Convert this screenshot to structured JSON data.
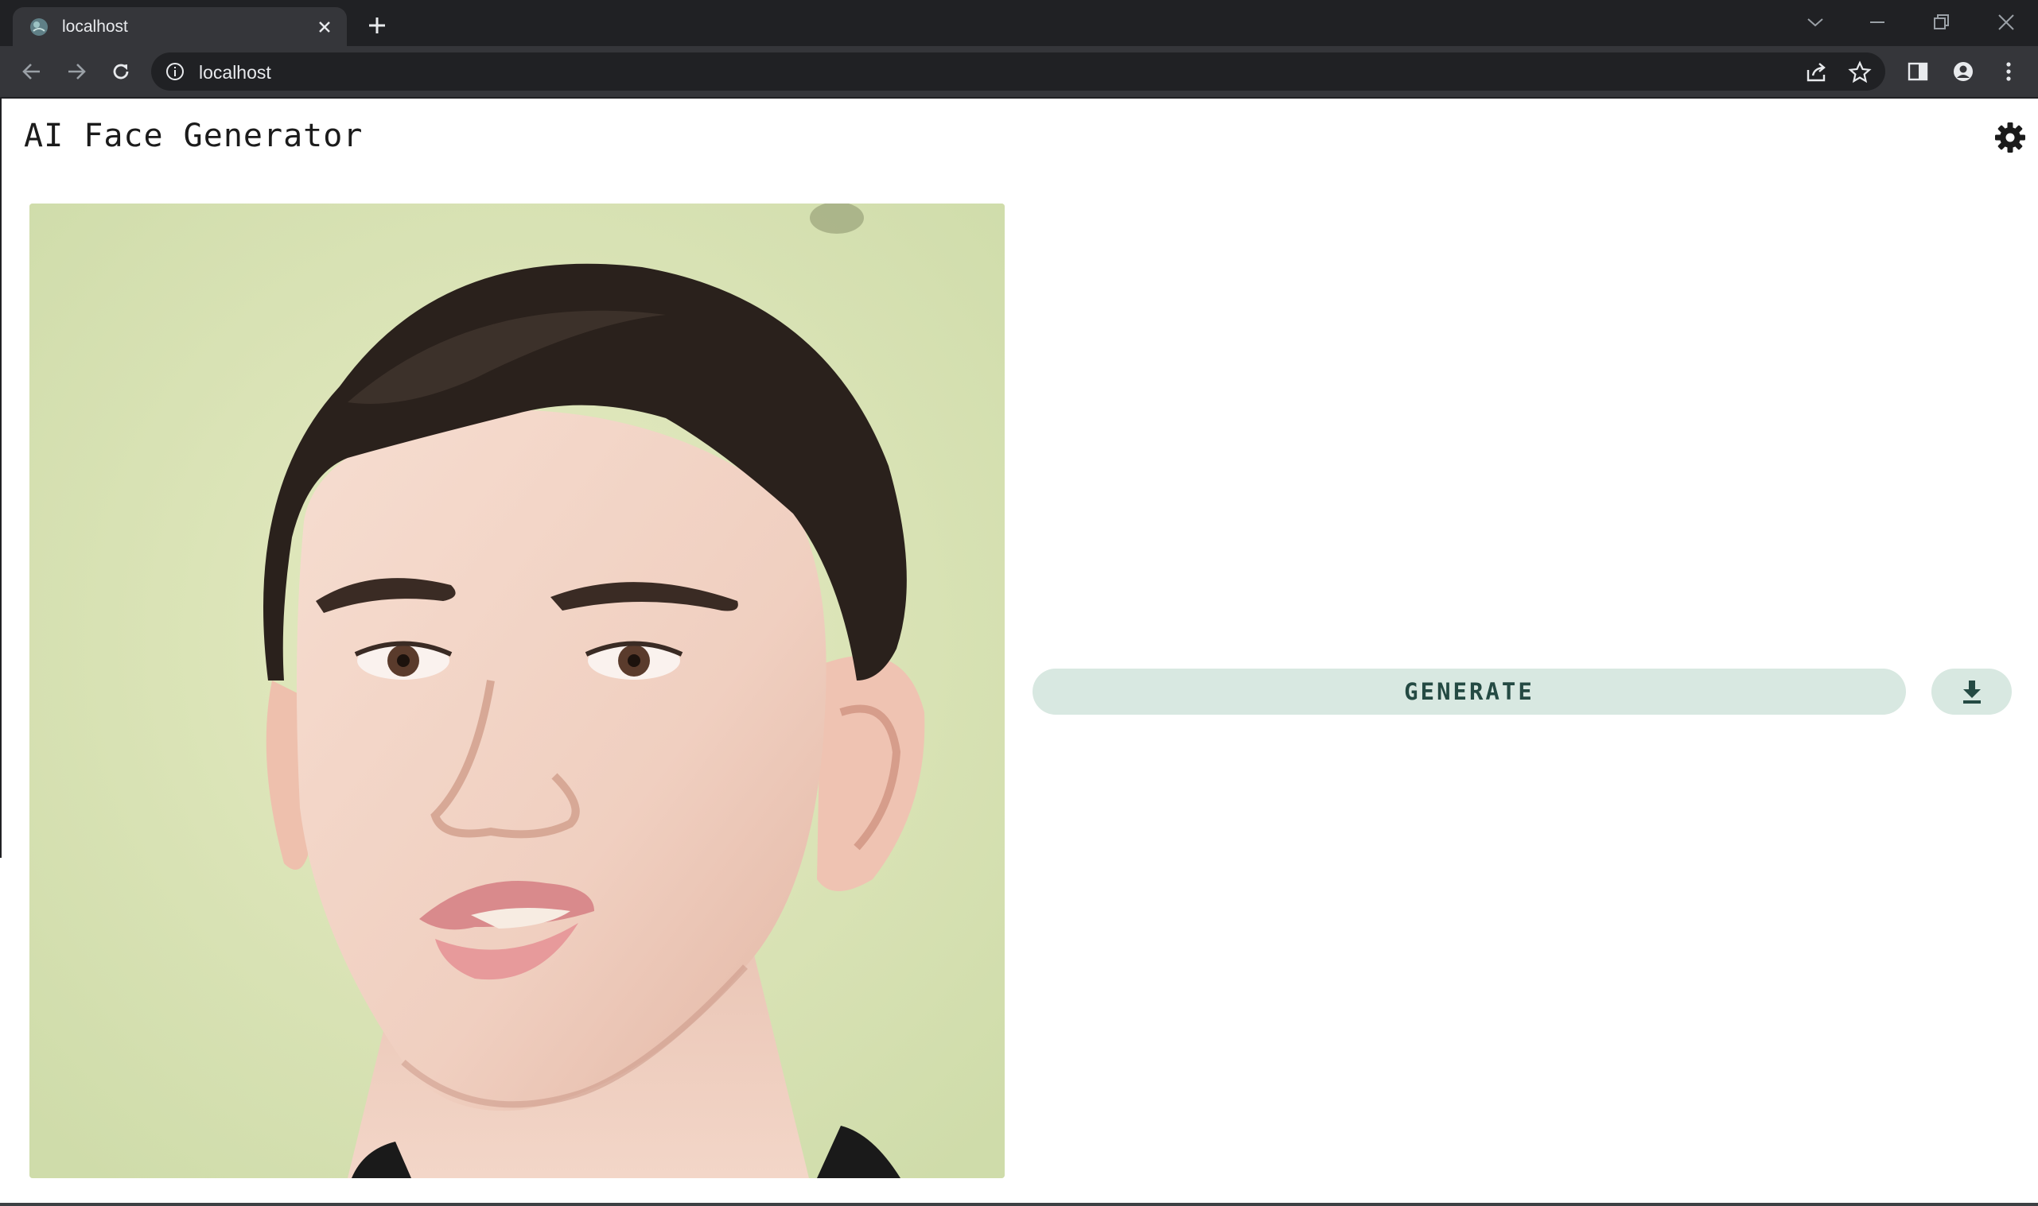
{
  "browser": {
    "tab": {
      "title": "localhost",
      "favicon": "app-favicon-icon"
    },
    "url": "localhost",
    "colors": {
      "frame": "#202124",
      "toolbar": "#35363a",
      "text": "#e8eaed"
    }
  },
  "app": {
    "title": "AI Face Generator",
    "settings_icon": "gear-icon",
    "image": {
      "description_icon": "generated-face-image"
    },
    "generate_label": "GENERATE",
    "download_icon": "download-icon",
    "colors": {
      "button_bg": "#d8e8e1",
      "button_text": "#244a43"
    }
  }
}
